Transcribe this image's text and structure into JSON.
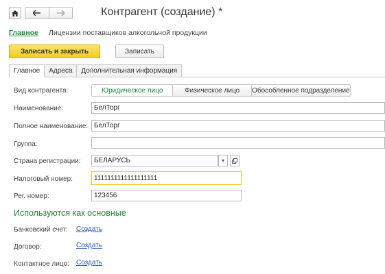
{
  "toolbar": {
    "home_icon": "home-icon",
    "back_icon": "arrow-left-icon",
    "forward_icon": "arrow-right-icon"
  },
  "title": "Контрагент (создание) *",
  "sublinks": {
    "main": "Главное",
    "licenses": "Лицензии поставщиков алкогольной продукции"
  },
  "actions": {
    "save_close": "Записать и закрыть",
    "save": "Записать"
  },
  "tabs": [
    {
      "label": "Главное",
      "active": true
    },
    {
      "label": "Адреса",
      "active": false
    },
    {
      "label": "Дополнительная информация",
      "active": false
    }
  ],
  "form": {
    "kind_label": "Вид контрагента:",
    "kind_options": [
      {
        "label": "Юридическое лицо",
        "selected": true
      },
      {
        "label": "Физическое лицо",
        "selected": false
      },
      {
        "label": "Обособленное подразделение",
        "selected": false
      }
    ],
    "name_label": "Наименование:",
    "name_value": "БелТорг",
    "fullname_label": "Полное наименование:",
    "fullname_value": "БелТорг",
    "group_label": "Группа:",
    "group_value": "",
    "country_label": "Страна регистрации:",
    "country_value": "БЕЛАРУСЬ",
    "tax_label": "Налоговый номер:",
    "tax_value": "1111111111111111111",
    "reg_label": "Рег. номер:",
    "reg_value": "123456"
  },
  "defaults": {
    "heading": "Используются как основные",
    "bank_label": "Банковский счет:",
    "contract_label": "Договор:",
    "contact_label": "Контактное лицо:",
    "create_link": "Создать"
  },
  "colors": {
    "accent_green": "#1a8a3b",
    "primary_button": "#f5cc23",
    "link_blue": "#2a55b4",
    "focus_border": "#f1c232"
  }
}
